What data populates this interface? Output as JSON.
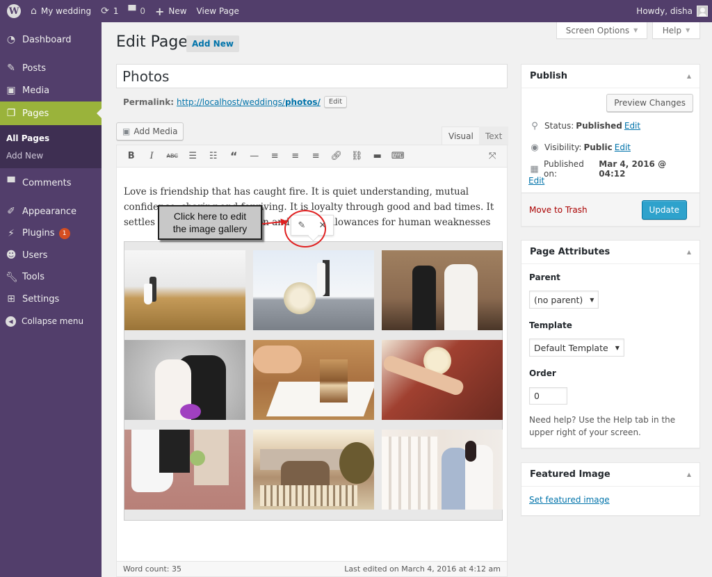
{
  "adminbar": {
    "site_name": "My wedding",
    "updates_count": "1",
    "comments_count": "0",
    "new_label": "New",
    "view_page_label": "View Page",
    "howdy": "Howdy, disha"
  },
  "sidebar": {
    "items": [
      {
        "label": "Dashboard",
        "icon": "dashboard-icon"
      },
      {
        "label": "Posts",
        "icon": "pin-icon"
      },
      {
        "label": "Media",
        "icon": "media-icon"
      },
      {
        "label": "Pages",
        "icon": "pages-icon",
        "active": true
      },
      {
        "label": "Comments",
        "icon": "comment-icon"
      },
      {
        "label": "Appearance",
        "icon": "paintbrush-icon"
      },
      {
        "label": "Plugins",
        "icon": "plug-icon",
        "badge": "1"
      },
      {
        "label": "Users",
        "icon": "user-icon"
      },
      {
        "label": "Tools",
        "icon": "wrench-icon"
      },
      {
        "label": "Settings",
        "icon": "sliders-icon"
      }
    ],
    "pages_submenu": [
      "All Pages",
      "Add New"
    ],
    "collapse_label": "Collapse menu"
  },
  "screen_meta": {
    "screen_options": "Screen Options",
    "help": "Help"
  },
  "header": {
    "title": "Edit Page",
    "add_new": "Add New"
  },
  "post": {
    "title": "Photos",
    "permalink_label": "Permalink:",
    "permalink_base": "http://localhost/weddings/",
    "permalink_slug": "photos/",
    "permalink_edit": "Edit"
  },
  "editor": {
    "add_media": "Add Media",
    "tabs": [
      "Visual",
      "Text"
    ],
    "active_tab": "Visual",
    "toolbar": [
      "bold",
      "italic",
      "strikethrough",
      "bulleted-list",
      "numbered-list",
      "blockquote",
      "horizontal-line",
      "align-left",
      "align-center",
      "align-right",
      "insert-link",
      "remove-link",
      "read-more",
      "toolbar-toggle",
      "fullscreen"
    ],
    "content_text": "Love is friendship that has caught fire. It is quiet understanding, mutual confidence, sharing and forgiving. It is loyalty through good and bad times. It settles for less than perfection and makes allowances for human weaknesses",
    "gallery": {
      "image_count": 9,
      "images": [
        {
          "desc": "couple on grassy hill by the sea",
          "colors": [
            "#f4f4f4",
            "#b08a4a"
          ]
        },
        {
          "desc": "bridal bouquet on pier",
          "colors": [
            "#dbe6f0",
            "#8a9099"
          ]
        },
        {
          "desc": "couple with falling petals",
          "colors": [
            "#8a6a50",
            "#2a2a2a"
          ]
        },
        {
          "desc": "bride and groom portrait",
          "colors": [
            "#d0d0d0",
            "#222222"
          ]
        },
        {
          "desc": "slice of wedding cake",
          "colors": [
            "#c98a4a",
            "#f6f2ec"
          ]
        },
        {
          "desc": "holding hands with bouquet",
          "colors": [
            "#8a3a2a",
            "#e8d0b0"
          ]
        },
        {
          "desc": "couple on brick path",
          "colors": [
            "#c08a80",
            "#f4f4f4"
          ]
        },
        {
          "desc": "couple on bench by palace",
          "colors": [
            "#f0e4c8",
            "#9a7a50"
          ]
        },
        {
          "desc": "couple kissing by balustrade",
          "colors": [
            "#f2ede8",
            "#8aa0c0"
          ]
        }
      ]
    },
    "gallery_toolbar": {
      "edit_icon": "pencil-icon",
      "remove_icon": "close-icon"
    },
    "word_count": "Word count: 35",
    "last_edited": "Last edited on March 4, 2016 at 4:12 am"
  },
  "annotation": {
    "line1": "Click here to edit",
    "line2": "the image gallery",
    "accent": "#e02020"
  },
  "publish": {
    "title": "Publish",
    "preview_changes": "Preview Changes",
    "status_label": "Status:",
    "status_value": "Published",
    "visibility_label": "Visibility:",
    "visibility_value": "Public",
    "published_on_label": "Published on:",
    "published_on_value": "Mar 4, 2016 @ 04:12",
    "edit": "Edit",
    "move_to_trash": "Move to Trash",
    "update": "Update"
  },
  "page_attributes": {
    "title": "Page Attributes",
    "parent_label": "Parent",
    "parent_value": "(no parent)",
    "template_label": "Template",
    "template_value": "Default Template",
    "order_label": "Order",
    "order_value": "0",
    "help_text": "Need help? Use the Help tab in the upper right of your screen."
  },
  "featured_image": {
    "title": "Featured Image",
    "link": "Set featured image"
  },
  "colors": {
    "adminbar": "#523e6b",
    "menu_active": "#9ab33b",
    "link": "#0073aa",
    "primary_button": "#2ea2cc",
    "badge": "#d54e21"
  }
}
